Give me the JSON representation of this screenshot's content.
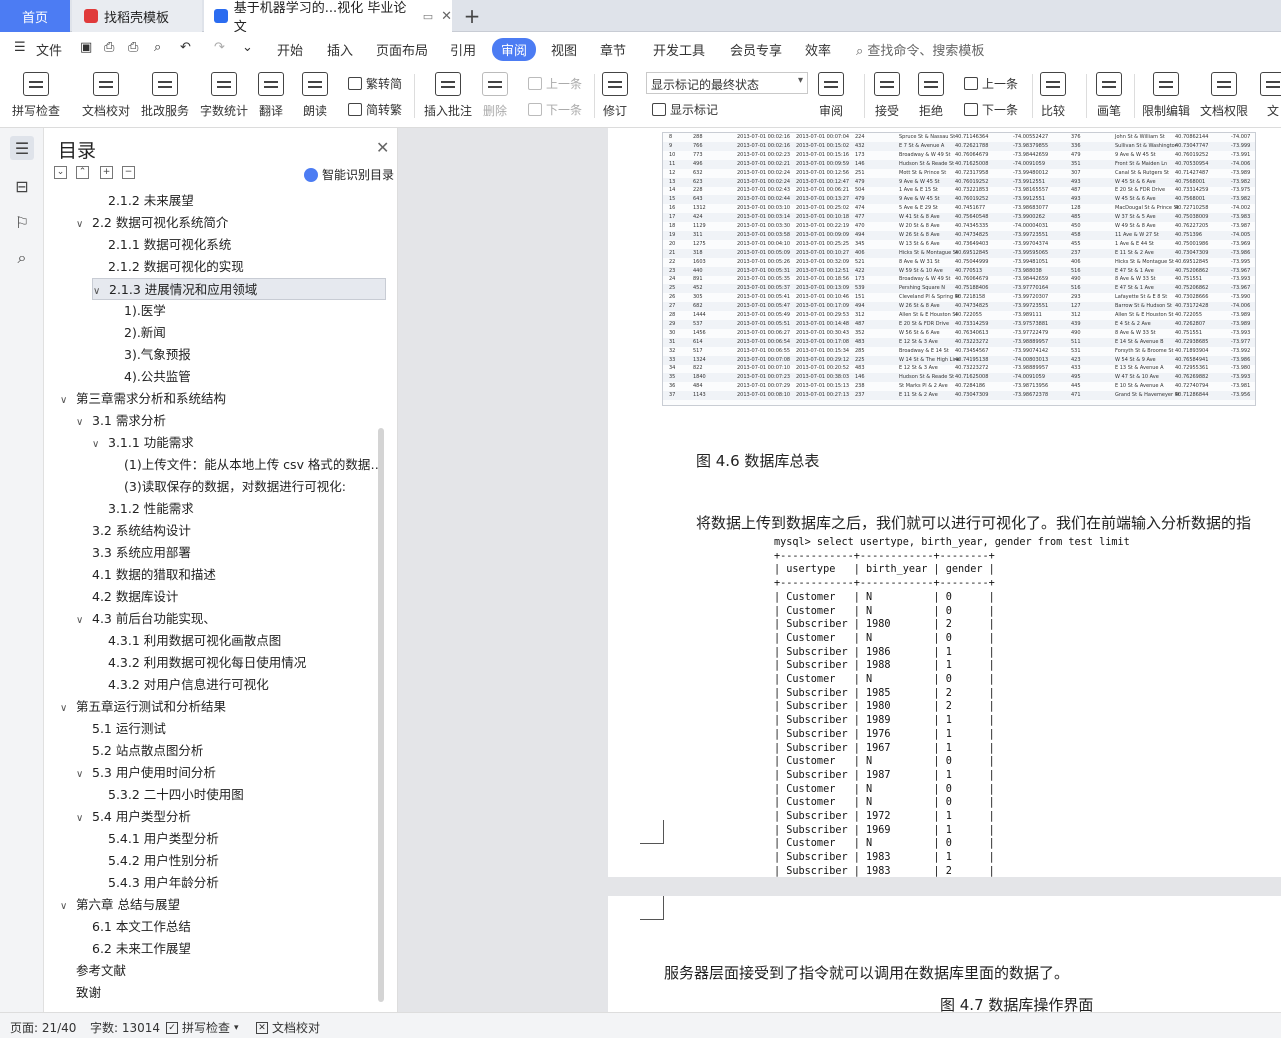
{
  "tabs": {
    "home": "首页",
    "template": "找稻壳模板",
    "document": "基于机器学习的...视化 毕业论文"
  },
  "menu": {
    "file": "文件",
    "items": [
      "开始",
      "插入",
      "页面布局",
      "引用",
      "审阅",
      "视图",
      "章节",
      "开发工具",
      "会员专享",
      "效率"
    ],
    "active": "审阅",
    "search": "查找命令、搜索模板"
  },
  "ribbon": {
    "spell_check": "拼写检查",
    "doc_proof": "文档校对",
    "batch_service": "批改服务",
    "word_count": "字数统计",
    "translate": "翻译",
    "read_aloud": "朗读",
    "trad_simp": "繁转简",
    "simp_trad": "简转繁",
    "insert_comment": "插入批注",
    "delete": "删除",
    "prev": "上一条",
    "next": "下一条",
    "revise": "修订",
    "mark_mode": "显示标记的最终状态",
    "show_marks": "显示标记",
    "review": "审阅",
    "accept": "接受",
    "reject": "拒绝",
    "prev2": "上一条",
    "next2": "下一条",
    "compare": "比较",
    "pen": "画笔",
    "restrict_edit": "限制编辑",
    "doc_permission": "文档权限",
    "doc_more": "文"
  },
  "toc": {
    "title": "目录",
    "ai_toc": "智能识别目录",
    "items": [
      {
        "text": "2.1.2  未来展望",
        "level": 3,
        "caret": ""
      },
      {
        "text": "2.2 数据可视化系统简介",
        "level": 2,
        "caret": "v"
      },
      {
        "text": "2.1.1 数据可视化系统",
        "level": 3,
        "caret": ""
      },
      {
        "text": "2.1.2  数据可视化的实现",
        "level": 3,
        "caret": ""
      },
      {
        "text": "2.1.3 进展情况和应用领域",
        "level": 3,
        "caret": "v",
        "selected": true
      },
      {
        "text": "1).医学",
        "level": 4,
        "caret": ""
      },
      {
        "text": "2).新闻",
        "level": 4,
        "caret": ""
      },
      {
        "text": "3).气象预报",
        "level": 4,
        "caret": ""
      },
      {
        "text": "4).公共监管",
        "level": 4,
        "caret": ""
      },
      {
        "text": "第三章需求分析和系统结构",
        "level": 1,
        "caret": "v"
      },
      {
        "text": "3.1 需求分析",
        "level": 2,
        "caret": "v"
      },
      {
        "text": "3.1.1 功能需求",
        "level": 3,
        "caret": "v"
      },
      {
        "text": "(1)上传文件：能从本地上传 csv 格式的数据 ...",
        "level": 4,
        "caret": ""
      },
      {
        "text": "(3)读取保存的数据，对数据进行可视化:",
        "level": 4,
        "caret": ""
      },
      {
        "text": "3.1.2 性能需求",
        "level": 3,
        "caret": ""
      },
      {
        "text": "3.2 系统结构设计",
        "level": 2,
        "caret": ""
      },
      {
        "text": "3.3 系统应用部署",
        "level": 2,
        "caret": ""
      },
      {
        "text": "4.1 数据的猎取和描述",
        "level": 2,
        "caret": ""
      },
      {
        "text": "4.2 数据库设计",
        "level": 2,
        "caret": ""
      },
      {
        "text": "4.3 前后台功能实现、",
        "level": 2,
        "caret": "v"
      },
      {
        "text": "4.3.1 利用数据可视化画散点图",
        "level": 3,
        "caret": ""
      },
      {
        "text": "4.3.2 利用数据可视化每日使用情况",
        "level": 3,
        "caret": ""
      },
      {
        "text": "4.3.2  对用户信息进行可视化",
        "level": 3,
        "caret": ""
      },
      {
        "text": "第五章运行测试和分析结果",
        "level": 1,
        "caret": "v"
      },
      {
        "text": "5.1  运行测试",
        "level": 2,
        "caret": ""
      },
      {
        "text": "5.2  站点散点图分析",
        "level": 2,
        "caret": ""
      },
      {
        "text": "5.3 用户使用时间分析",
        "level": 2,
        "caret": "v"
      },
      {
        "text": "5.3.2 二十四小时使用图",
        "level": 3,
        "caret": ""
      },
      {
        "text": "5.4  用户类型分析",
        "level": 2,
        "caret": "v"
      },
      {
        "text": "5.4.1 用户类型分析",
        "level": 3,
        "caret": ""
      },
      {
        "text": "5.4.2  用户性别分析",
        "level": 3,
        "caret": ""
      },
      {
        "text": "5.4.3 用户年龄分析",
        "level": 3,
        "caret": ""
      },
      {
        "text": "第六章  总结与展望",
        "level": 1,
        "caret": "v"
      },
      {
        "text": "6.1  本文工作总结",
        "level": 2,
        "caret": ""
      },
      {
        "text": "6.2 未来工作展望",
        "level": 2,
        "caret": ""
      },
      {
        "text": "参考文献",
        "level": 1,
        "caret": ""
      },
      {
        "text": "致谢",
        "level": 1,
        "caret": ""
      }
    ]
  },
  "document": {
    "db_rows": [
      [
        "8",
        "288",
        "2013-07-01 00:02:16",
        "2013-07-01 00:07:04",
        "224",
        "Spruce St & Nassau St",
        "40.71146364",
        "-74.00552427",
        "376",
        "John St & William St",
        "40.70862144",
        "-74.007"
      ],
      [
        "9",
        "766",
        "2013-07-01 00:02:16",
        "2013-07-01 00:15:02",
        "432",
        "E 7 St & Avenue A",
        "40.72621788",
        "-73.98379855",
        "336",
        "Sullivan St & Washington",
        "40.73047747",
        "-73.999"
      ],
      [
        "10",
        "773",
        "2013-07-01 00:02:23",
        "2013-07-01 00:15:16",
        "173",
        "Broadway & W 49 St",
        "40.76064679",
        "-73.98442659",
        "479",
        "9 Ave & W 45 St",
        "40.76019252",
        "-73.991"
      ],
      [
        "11",
        "496",
        "2013-07-01 00:02:21",
        "2013-07-01 00:09:59",
        "146",
        "Hudson St & Reade St",
        "40.71625008",
        "-74.0091059",
        "351",
        "Front St & Maiden Ln",
        "40.70530954",
        "-74.006"
      ],
      [
        "12",
        "632",
        "2013-07-01 00:02:24",
        "2013-07-01 00:12:56",
        "251",
        "Mott St & Prince St",
        "40.72317958",
        "-73.99480012",
        "307",
        "Canal St & Rutgers St",
        "40.71427487",
        "-73.989"
      ],
      [
        "13",
        "623",
        "2013-07-01 00:02:24",
        "2013-07-01 00:12:47",
        "479",
        "9 Ave & W 45 St",
        "40.76019252",
        "-73.9912551",
        "493",
        "W 45 St & 6 Ave",
        "40.7568001",
        "-73.982"
      ],
      [
        "14",
        "228",
        "2013-07-01 00:02:43",
        "2013-07-01 00:06:21",
        "504",
        "1 Ave & E 15 St",
        "40.73221853",
        "-73.98165557",
        "487",
        "E 20 St & FDR Drive",
        "40.73314259",
        "-73.975"
      ],
      [
        "15",
        "643",
        "2013-07-01 00:02:44",
        "2013-07-01 00:13:27",
        "479",
        "9 Ave & W 45 St",
        "40.76019252",
        "-73.9912551",
        "493",
        "W 45 St & 6 Ave",
        "40.7568001",
        "-73.982"
      ],
      [
        "16",
        "1312",
        "2013-07-01 00:03:10",
        "2013-07-01 00:25:02",
        "474",
        "5 Ave & E 29 St",
        "40.7451677",
        "-73.98683077",
        "128",
        "MacDougal St & Prince St",
        "40.72710258",
        "-74.002"
      ],
      [
        "17",
        "424",
        "2013-07-01 00:03:14",
        "2013-07-01 00:10:18",
        "477",
        "W 41 St & 8 Ave",
        "40.75640548",
        "-73.9900262",
        "485",
        "W 37 St & 5 Ave",
        "40.75038009",
        "-73.983"
      ],
      [
        "18",
        "1129",
        "2013-07-01 00:03:30",
        "2013-07-01 00:22:19",
        "470",
        "W 20 St & 8 Ave",
        "40.74345335",
        "-74.00004031",
        "450",
        "W 49 St & 8 Ave",
        "40.76227205",
        "-73.987"
      ],
      [
        "19",
        "311",
        "2013-07-01 00:03:58",
        "2013-07-01 00:09:09",
        "494",
        "W 26 St & 8 Ave",
        "40.74734825",
        "-73.99723551",
        "458",
        "11 Ave & W 27 St",
        "40.751396",
        "-74.005"
      ],
      [
        "20",
        "1275",
        "2013-07-01 00:04:10",
        "2013-07-01 00:25:25",
        "345",
        "W 13 St & 6 Ave",
        "40.73649403",
        "-73.99704374",
        "455",
        "1 Ave & E 44 St",
        "40.75001986",
        "-73.969"
      ],
      [
        "21",
        "318",
        "2013-07-01 00:05:09",
        "2013-07-01 00:10:27",
        "406",
        "Hicks St & Montague St",
        "40.69512845",
        "-73.99595065",
        "237",
        "E 11 St & 2 Ave",
        "40.73047309",
        "-73.986"
      ],
      [
        "22",
        "1603",
        "2013-07-01 00:05:26",
        "2013-07-01 00:32:09",
        "521",
        "8 Ave & W 31 St",
        "40.75044999",
        "-73.99481051",
        "406",
        "Hicks St & Montague St",
        "40.69512845",
        "-73.995"
      ],
      [
        "23",
        "440",
        "2013-07-01 00:05:31",
        "2013-07-01 00:12:51",
        "422",
        "W 59 St & 10 Ave",
        "40.770513",
        "-73.988038",
        "516",
        "E 47 St & 1 Ave",
        "40.75206862",
        "-73.967"
      ],
      [
        "24",
        "891",
        "2013-07-01 00:05:35",
        "2013-07-01 00:18:56",
        "173",
        "Broadway & W 49 St",
        "40.76064679",
        "-73.98442659",
        "490",
        "8 Ave & W 33 St",
        "40.751551",
        "-73.993"
      ],
      [
        "25",
        "452",
        "2013-07-01 00:05:37",
        "2013-07-01 00:13:09",
        "539",
        "Pershing Square N",
        "40.75188406",
        "-73.97770164",
        "516",
        "E 47 St & 1 Ave",
        "40.75206862",
        "-73.967"
      ],
      [
        "26",
        "305",
        "2013-07-01 00:05:41",
        "2013-07-01 00:10:46",
        "151",
        "Cleveland Pl & Spring St",
        "40.7218158",
        "-73.99720307",
        "293",
        "Lafayette St & E 8 St",
        "40.73028666",
        "-73.990"
      ],
      [
        "27",
        "682",
        "2013-07-01 00:05:47",
        "2013-07-01 00:17:09",
        "494",
        "W 26 St & 8 Ave",
        "40.74734825",
        "-73.99723551",
        "127",
        "Barrow St & Hudson St",
        "40.73172428",
        "-74.006"
      ],
      [
        "28",
        "1444",
        "2013-07-01 00:05:49",
        "2013-07-01 00:29:53",
        "312",
        "Allen St & E Houston St",
        "40.722055",
        "-73.989111",
        "312",
        "Allen St & E Houston St",
        "40.722055",
        "-73.989"
      ],
      [
        "29",
        "537",
        "2013-07-01 00:05:51",
        "2013-07-01 00:14:48",
        "487",
        "E 20 St & FDR Drive",
        "40.73314259",
        "-73.97573881",
        "439",
        "E 4 St & 2 Ave",
        "40.7262807",
        "-73.989"
      ],
      [
        "30",
        "1456",
        "2013-07-01 00:06:27",
        "2013-07-01 00:30:43",
        "352",
        "W 56 St & 6 Ave",
        "40.76340613",
        "-73.97722479",
        "490",
        "8 Ave & W 33 St",
        "40.751551",
        "-73.993"
      ],
      [
        "31",
        "614",
        "2013-07-01 00:06:54",
        "2013-07-01 00:17:08",
        "483",
        "E 12 St & 3 Ave",
        "40.73223272",
        "-73.98889957",
        "511",
        "E 14 St & Avenue B",
        "40.72938685",
        "-73.977"
      ],
      [
        "32",
        "517",
        "2013-07-01 00:06:55",
        "2013-07-01 00:15:34",
        "285",
        "Broadway & E 14 St",
        "40.73454567",
        "-73.99074142",
        "531",
        "Forsyth St & Broome St",
        "40.71893904",
        "-73.992"
      ],
      [
        "33",
        "1324",
        "2013-07-01 00:07:08",
        "2013-07-01 00:29:12",
        "225",
        "W 14 St & The High Line",
        "40.74195138",
        "-74.00803013",
        "423",
        "W 54 St & 9 Ave",
        "40.76584941",
        "-73.986"
      ],
      [
        "34",
        "822",
        "2013-07-01 00:07:10",
        "2013-07-01 00:20:52",
        "483",
        "E 12 St & 3 Ave",
        "40.73223272",
        "-73.98889957",
        "433",
        "E 13 St & Avenue A",
        "40.72955361",
        "-73.980"
      ],
      [
        "35",
        "1840",
        "2013-07-01 00:07:23",
        "2013-07-01 00:38:03",
        "146",
        "Hudson St & Reade St",
        "40.71625008",
        "-74.0091059",
        "495",
        "W 47 St & 10 Ave",
        "40.76269882",
        "-73.993"
      ],
      [
        "36",
        "484",
        "2013-07-01 00:07:29",
        "2013-07-01 00:15:13",
        "238",
        "St Marks Pl & 2 Ave",
        "40.7284186",
        "-73.98713956",
        "445",
        "E 10 St & Avenue A",
        "40.72740794",
        "-73.981"
      ],
      [
        "37",
        "1143",
        "2013-07-01 00:08:10",
        "2013-07-01 00:27:13",
        "237",
        "E 11 St & 2 Ave",
        "40.73047309",
        "-73.98672378",
        "471",
        "Grand St & Havemeyer St",
        "40.71286844",
        "-73.956"
      ]
    ],
    "fig46": "图 4.6  数据库总表",
    "para1": "将数据上传到数据库之后，我们就可以进行可视化了。我们在前端输入分析数据的指",
    "mysql_lines": [
      "mysql> select usertype, birth_year, gender from test limit 100;",
      "+------------+------------+--------+",
      "| usertype   | birth_year | gender |",
      "+------------+------------+--------+",
      "| Customer   | N          | 0      |",
      "| Customer   | N          | 0      |",
      "| Subscriber | 1980       | 2      |",
      "| Customer   | N          | 0      |",
      "| Subscriber | 1986       | 1      |",
      "| Subscriber | 1988       | 1      |",
      "| Customer   | N          | 0      |",
      "| Subscriber | 1985       | 2      |",
      "| Subscriber | 1980       | 2      |",
      "| Subscriber | 1989       | 1      |",
      "| Subscriber | 1976       | 1      |",
      "| Subscriber | 1967       | 1      |",
      "| Customer   | N          | 0      |",
      "| Subscriber | 1987       | 1      |",
      "| Customer   | N          | 0      |",
      "| Customer   | N          | 0      |",
      "| Subscriber | 1972       | 1      |",
      "| Subscriber | 1969       | 1      |",
      "| Customer   | N          | 0      |",
      "| Subscriber | 1983       | 1      |",
      "| Subscriber | 1983       | 2      |"
    ],
    "para2": "服务器层面接受到了指令就可以调用在数据库里面的数据了。",
    "fig47": "图 4.7  数据库操作界面"
  },
  "status": {
    "page": "页面: 21/40",
    "words": "字数: 13014",
    "spell": "拼写检查",
    "proof": "文档校对"
  }
}
